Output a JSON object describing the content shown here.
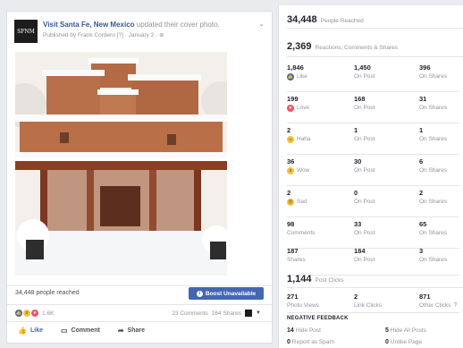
{
  "post": {
    "avatar_text": "SFNM",
    "page_name": "Visit Santa Fe, New Mexico",
    "action": " updated their cover photo.",
    "byline": "Published by Frank Cordero [?] · January 2 · ",
    "globe_icon": "globe-icon",
    "reach_text": "34,448 people reached",
    "boost_label": "Boost Unavailable",
    "reaction_count": "1.6K",
    "comments": "23 Comments",
    "shares": "164 Shares",
    "actions": {
      "like": "Like",
      "comment": "Comment",
      "share": "Share"
    }
  },
  "insights": {
    "people_reached": {
      "value": "34,448",
      "label": "People Reached"
    },
    "engagement": {
      "value": "2,369",
      "label": "Reactions, Comments & Shares"
    },
    "rows": [
      {
        "icon": "like-icon",
        "label": "Like",
        "total": "1,846",
        "on_post": "1,450",
        "on_shares": "396"
      },
      {
        "icon": "love-icon",
        "label": "Love",
        "total": "199",
        "on_post": "168",
        "on_shares": "31"
      },
      {
        "icon": "haha-icon",
        "label": "Haha",
        "total": "2",
        "on_post": "1",
        "on_shares": "1"
      },
      {
        "icon": "wow-icon",
        "label": "Wow",
        "total": "36",
        "on_post": "30",
        "on_shares": "6"
      },
      {
        "icon": "sad-icon",
        "label": "Sad",
        "total": "2",
        "on_post": "0",
        "on_shares": "2"
      },
      {
        "icon": "",
        "label": "Comments",
        "total": "98",
        "on_post": "33",
        "on_shares": "65"
      },
      {
        "icon": "",
        "label": "Shares",
        "total": "187",
        "on_post": "184",
        "on_shares": "3"
      }
    ],
    "on_post_label": "On Post",
    "on_shares_label": "On Shares",
    "post_clicks": {
      "value": "1,144",
      "label": "Post Clicks"
    },
    "clicks": [
      {
        "value": "271",
        "label": "Photo Views"
      },
      {
        "value": "2",
        "label": "Link Clicks"
      },
      {
        "value": "871",
        "label": "Other Clicks"
      }
    ],
    "negative_title": "NEGATIVE FEEDBACK",
    "negative": [
      {
        "value": "14",
        "label": "Hide Post"
      },
      {
        "value": "5",
        "label": "Hide All Posts"
      },
      {
        "value": "0",
        "label": "Report as Spam"
      },
      {
        "value": "0",
        "label": "Unlike Page"
      }
    ]
  }
}
